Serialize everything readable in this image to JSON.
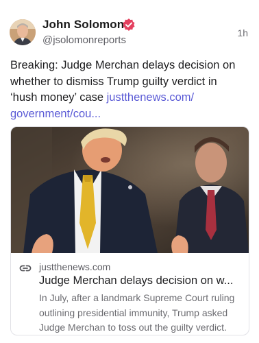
{
  "author": {
    "name": "John Solomon",
    "handle": "@jsolomonreports",
    "verified_badge_icon": "verified-badge-icon",
    "avatar": "avatar-photo"
  },
  "post": {
    "time": "1h",
    "text": "Breaking: Judge Merchan delays decision on whether to dismiss Trump guilty verdict in ‘hush money’ case ",
    "link_text": "justthenews.com/\ngovernment/cou..."
  },
  "link_card": {
    "domain": "justthenews.com",
    "title": "Judge Merchan delays decision on w...",
    "description": "In July, after a landmark Supreme Court ruling outlining presidential immunity, Trump asked Judge Merchan to toss out the guilty verdict.",
    "link_icon": "link-icon",
    "image": "news-photo"
  },
  "colors": {
    "accent_link": "#5b5bd6",
    "badge": "#e4405f",
    "muted_text": "#6b6b70"
  }
}
